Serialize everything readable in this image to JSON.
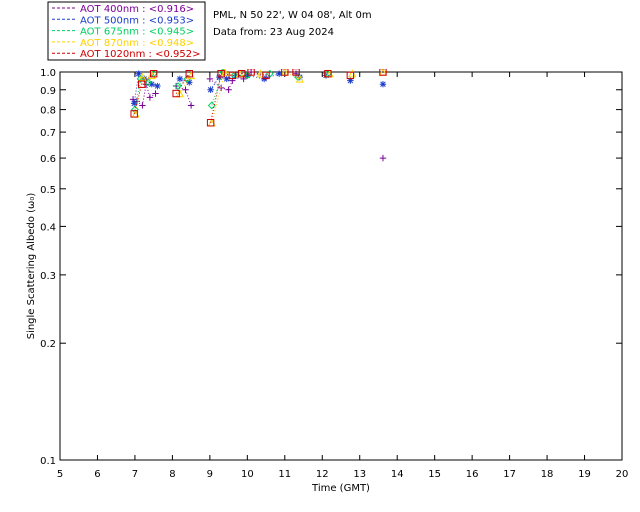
{
  "header": {
    "site": "PML, N 50 22', W 04 08', Alt 0m",
    "date": "Data from: 23 Aug 2024"
  },
  "legend": [
    {
      "label": "AOT  400nm : <0.916>",
      "color": "#7b0099"
    },
    {
      "label": "AOT  500nm : <0.953>",
      "color": "#1a3ccc"
    },
    {
      "label": "AOT  675nm : <0.945>",
      "color": "#00d060"
    },
    {
      "label": "AOT  870nm : <0.948>",
      "color": "#ffd000"
    },
    {
      "label": "AOT 1020nm : <0.952>",
      "color": "#cc0000"
    }
  ],
  "chart_data": {
    "type": "scatter",
    "xlabel": "Time (GMT)",
    "ylabel": "Single Scattering Albedo (ω₀)",
    "xlim": [
      5,
      20
    ],
    "ylim": [
      0.1,
      1.0
    ],
    "yscale": "log",
    "xticks": [
      5,
      6,
      7,
      8,
      9,
      10,
      11,
      12,
      13,
      14,
      15,
      16,
      17,
      18,
      19,
      20
    ],
    "yticks": [
      {
        "value": 1.0,
        "label": "1.0"
      },
      {
        "value": 0.9,
        "label": "0.9"
      },
      {
        "value": 0.8,
        "label": "0.8"
      },
      {
        "value": 0.7,
        "label": "0.7"
      },
      {
        "value": 0.6,
        "label": "0.6"
      },
      {
        "value": 0.5,
        "label": "0.5"
      },
      {
        "value": 0.4,
        "label": "0.4"
      },
      {
        "value": 0.3,
        "label": "0.3"
      },
      {
        "value": 0.2,
        "label": "0.2"
      },
      {
        "value": 0.1,
        "label": "0.1"
      }
    ],
    "series": [
      {
        "name": "AOT  400nm",
        "marker": "plus",
        "color": "#7b0099",
        "x": [
          6.95,
          7.05,
          7.2,
          7.3,
          7.4,
          7.55,
          8.1,
          8.35,
          8.5,
          9.0,
          9.3,
          9.5,
          9.6,
          9.75,
          9.9,
          10.1,
          10.5,
          11.3,
          13.62
        ],
        "y": [
          0.85,
          0.84,
          0.82,
          0.93,
          0.86,
          0.88,
          0.92,
          0.9,
          0.82,
          0.96,
          0.91,
          0.9,
          0.95,
          0.98,
          0.96,
          1.0,
          0.97,
          0.99,
          0.6
        ]
      },
      {
        "name": "AOT  500nm",
        "marker": "asterisk",
        "color": "#1a3ccc",
        "x": [
          6.98,
          7.1,
          7.25,
          7.45,
          7.6,
          8.2,
          8.45,
          9.02,
          9.25,
          9.45,
          9.7,
          10.0,
          10.45,
          10.85,
          11.4,
          12.1,
          12.75,
          13.62
        ],
        "y": [
          0.83,
          0.99,
          0.96,
          0.93,
          0.92,
          0.96,
          0.94,
          0.9,
          0.97,
          0.96,
          0.98,
          0.98,
          0.96,
          0.99,
          0.97,
          0.98,
          0.95,
          0.93
        ]
      },
      {
        "name": "AOT  675nm",
        "marker": "diamond",
        "color": "#00d060",
        "x": [
          7.0,
          7.15,
          7.35,
          7.5,
          8.15,
          8.4,
          9.05,
          9.35,
          9.65,
          10.0,
          10.6,
          11.35,
          12.15
        ],
        "y": [
          0.8,
          0.96,
          0.94,
          0.99,
          0.92,
          0.96,
          0.82,
          1.0,
          0.98,
          0.98,
          0.99,
          0.97,
          0.99
        ]
      },
      {
        "name": "AOT  870nm",
        "marker": "triangle",
        "color": "#ffd000",
        "x": [
          7.02,
          7.2,
          7.45,
          8.2,
          8.5,
          9.05,
          9.4,
          9.8,
          10.35,
          11.0,
          11.4,
          12.2,
          12.8,
          13.62
        ],
        "y": [
          0.78,
          0.97,
          0.98,
          0.88,
          0.98,
          0.74,
          1.0,
          0.99,
          0.99,
          1.0,
          0.96,
          0.99,
          0.99,
          1.0
        ]
      },
      {
        "name": "AOT 1020nm",
        "marker": "square",
        "color": "#cc0000",
        "x": [
          6.98,
          7.18,
          7.5,
          8.1,
          8.45,
          9.02,
          9.3,
          9.6,
          9.85,
          10.1,
          10.5,
          11.0,
          11.3,
          12.15,
          12.75,
          13.62
        ],
        "y": [
          0.78,
          0.93,
          0.99,
          0.88,
          0.99,
          0.74,
          0.99,
          0.98,
          0.99,
          1.0,
          0.98,
          1.0,
          1.0,
          0.99,
          0.98,
          1.0
        ]
      }
    ]
  }
}
